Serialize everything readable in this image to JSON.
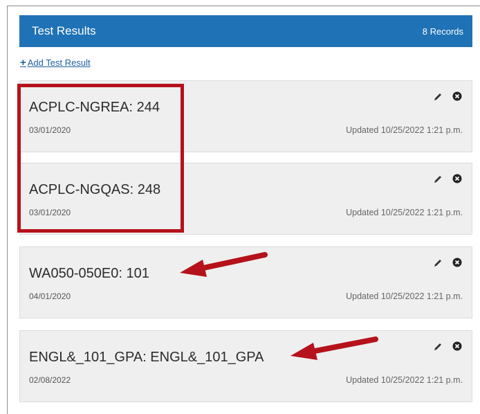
{
  "header": {
    "title": "Test Results",
    "records": "8 Records"
  },
  "add_link": {
    "label": " Add Test Result"
  },
  "icons": {
    "plus": "plus-icon",
    "edit": "pencil-icon",
    "delete": "close-circle-icon",
    "annotation_arrow": "red-arrow"
  },
  "colors": {
    "header_bg": "#1f72b5",
    "card_bg": "#efefef",
    "highlight": "#b5121b",
    "link": "#1f5fa0"
  },
  "records": [
    {
      "title": "ACPLC-NGREA: 244",
      "date": "03/01/2020",
      "updated": "Updated 10/25/2022 1:21 p.m."
    },
    {
      "title": "ACPLC-NGQAS: 248",
      "date": "03/01/2020",
      "updated": "Updated 10/25/2022 1:21 p.m."
    },
    {
      "title": "WA050-050E0: 101",
      "date": "04/01/2020",
      "updated": "Updated 10/25/2022 1:21 p.m."
    },
    {
      "title": "ENGL&_101_GPA: ENGL&_101_GPA",
      "date": "02/08/2022",
      "updated": "Updated 10/25/2022 1:21 p.m."
    }
  ]
}
